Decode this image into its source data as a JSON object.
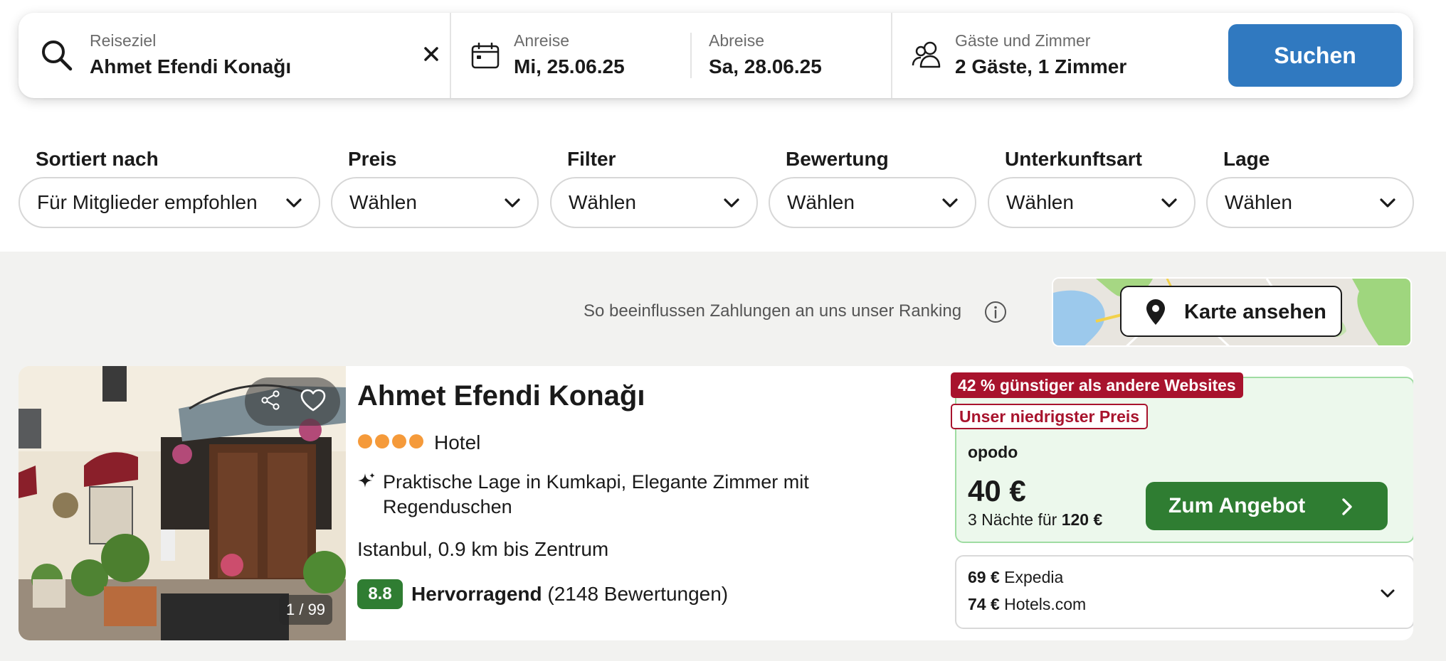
{
  "search": {
    "destination_label": "Reiseziel",
    "destination_value": "Ahmet Efendi Konağı",
    "checkin_label": "Anreise",
    "checkin_value": "Mi, 25.06.25",
    "checkout_label": "Abreise",
    "checkout_value": "Sa, 28.06.25",
    "guests_label": "Gäste und Zimmer",
    "guests_value": "2 Gäste, 1 Zimmer",
    "button_label": "Suchen"
  },
  "filters": [
    {
      "label": "Sortiert nach",
      "value": "Für Mitglieder empfohlen"
    },
    {
      "label": "Preis",
      "value": "Wählen"
    },
    {
      "label": "Filter",
      "value": "Wählen"
    },
    {
      "label": "Bewertung",
      "value": "Wählen"
    },
    {
      "label": "Unterkunftsart",
      "value": "Wählen"
    },
    {
      "label": "Lage",
      "value": "Wählen"
    }
  ],
  "ranking_note": "So beeinflussen Zahlungen an uns unser Ranking",
  "map_button": "Karte ansehen",
  "result": {
    "name": "Ahmet Efendi Konağı",
    "stars": 4,
    "type": "Hotel",
    "highlight": "Praktische Lage in Kumkapi, Elegante Zimmer mit Regenduschen",
    "location": "Istanbul, 0.9 km bis Zentrum",
    "rating": "8.8",
    "rating_label": "Hervorragend",
    "rating_count": "(2148 Bewertungen)",
    "photo_counter": "1 / 99",
    "badge_discount": "42 % günstiger als andere Websites",
    "badge_lowest": "Unser niedrigster Preis",
    "provider": "opodo",
    "price": "40 €",
    "price_total_prefix": "3 Nächte für",
    "price_total": "120 €",
    "deal_button": "Zum Angebot",
    "other_offers": [
      {
        "price": "69 €",
        "provider": "Expedia"
      },
      {
        "price": "74 €",
        "provider": "Hotels.com"
      }
    ]
  },
  "colors": {
    "primary_blue": "#3079c0",
    "deal_green": "#2f7d32",
    "badge_red": "#a8132d",
    "star_orange": "#f59a3a",
    "offer_bg": "#ecf8ec"
  }
}
